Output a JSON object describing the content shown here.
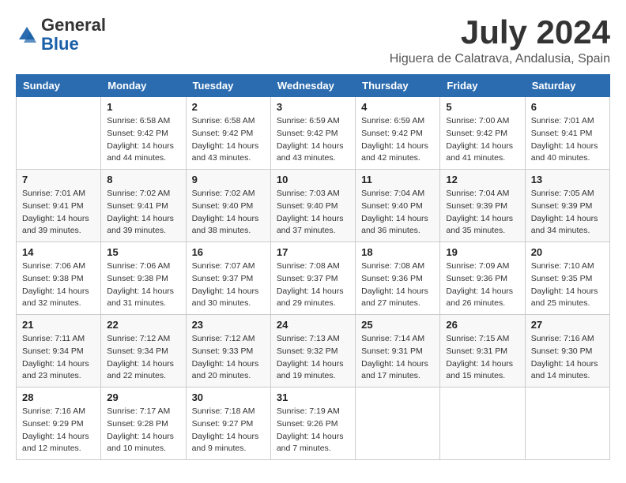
{
  "logo": {
    "general": "General",
    "blue": "Blue"
  },
  "header": {
    "month_title": "July 2024",
    "location": "Higuera de Calatrava, Andalusia, Spain"
  },
  "days_of_week": [
    "Sunday",
    "Monday",
    "Tuesday",
    "Wednesday",
    "Thursday",
    "Friday",
    "Saturday"
  ],
  "weeks": [
    [
      {
        "day": "",
        "info": ""
      },
      {
        "day": "1",
        "info": "Sunrise: 6:58 AM\nSunset: 9:42 PM\nDaylight: 14 hours\nand 44 minutes."
      },
      {
        "day": "2",
        "info": "Sunrise: 6:58 AM\nSunset: 9:42 PM\nDaylight: 14 hours\nand 43 minutes."
      },
      {
        "day": "3",
        "info": "Sunrise: 6:59 AM\nSunset: 9:42 PM\nDaylight: 14 hours\nand 43 minutes."
      },
      {
        "day": "4",
        "info": "Sunrise: 6:59 AM\nSunset: 9:42 PM\nDaylight: 14 hours\nand 42 minutes."
      },
      {
        "day": "5",
        "info": "Sunrise: 7:00 AM\nSunset: 9:42 PM\nDaylight: 14 hours\nand 41 minutes."
      },
      {
        "day": "6",
        "info": "Sunrise: 7:01 AM\nSunset: 9:41 PM\nDaylight: 14 hours\nand 40 minutes."
      }
    ],
    [
      {
        "day": "7",
        "info": "Sunrise: 7:01 AM\nSunset: 9:41 PM\nDaylight: 14 hours\nand 39 minutes."
      },
      {
        "day": "8",
        "info": "Sunrise: 7:02 AM\nSunset: 9:41 PM\nDaylight: 14 hours\nand 39 minutes."
      },
      {
        "day": "9",
        "info": "Sunrise: 7:02 AM\nSunset: 9:40 PM\nDaylight: 14 hours\nand 38 minutes."
      },
      {
        "day": "10",
        "info": "Sunrise: 7:03 AM\nSunset: 9:40 PM\nDaylight: 14 hours\nand 37 minutes."
      },
      {
        "day": "11",
        "info": "Sunrise: 7:04 AM\nSunset: 9:40 PM\nDaylight: 14 hours\nand 36 minutes."
      },
      {
        "day": "12",
        "info": "Sunrise: 7:04 AM\nSunset: 9:39 PM\nDaylight: 14 hours\nand 35 minutes."
      },
      {
        "day": "13",
        "info": "Sunrise: 7:05 AM\nSunset: 9:39 PM\nDaylight: 14 hours\nand 34 minutes."
      }
    ],
    [
      {
        "day": "14",
        "info": "Sunrise: 7:06 AM\nSunset: 9:38 PM\nDaylight: 14 hours\nand 32 minutes."
      },
      {
        "day": "15",
        "info": "Sunrise: 7:06 AM\nSunset: 9:38 PM\nDaylight: 14 hours\nand 31 minutes."
      },
      {
        "day": "16",
        "info": "Sunrise: 7:07 AM\nSunset: 9:37 PM\nDaylight: 14 hours\nand 30 minutes."
      },
      {
        "day": "17",
        "info": "Sunrise: 7:08 AM\nSunset: 9:37 PM\nDaylight: 14 hours\nand 29 minutes."
      },
      {
        "day": "18",
        "info": "Sunrise: 7:08 AM\nSunset: 9:36 PM\nDaylight: 14 hours\nand 27 minutes."
      },
      {
        "day": "19",
        "info": "Sunrise: 7:09 AM\nSunset: 9:36 PM\nDaylight: 14 hours\nand 26 minutes."
      },
      {
        "day": "20",
        "info": "Sunrise: 7:10 AM\nSunset: 9:35 PM\nDaylight: 14 hours\nand 25 minutes."
      }
    ],
    [
      {
        "day": "21",
        "info": "Sunrise: 7:11 AM\nSunset: 9:34 PM\nDaylight: 14 hours\nand 23 minutes."
      },
      {
        "day": "22",
        "info": "Sunrise: 7:12 AM\nSunset: 9:34 PM\nDaylight: 14 hours\nand 22 minutes."
      },
      {
        "day": "23",
        "info": "Sunrise: 7:12 AM\nSunset: 9:33 PM\nDaylight: 14 hours\nand 20 minutes."
      },
      {
        "day": "24",
        "info": "Sunrise: 7:13 AM\nSunset: 9:32 PM\nDaylight: 14 hours\nand 19 minutes."
      },
      {
        "day": "25",
        "info": "Sunrise: 7:14 AM\nSunset: 9:31 PM\nDaylight: 14 hours\nand 17 minutes."
      },
      {
        "day": "26",
        "info": "Sunrise: 7:15 AM\nSunset: 9:31 PM\nDaylight: 14 hours\nand 15 minutes."
      },
      {
        "day": "27",
        "info": "Sunrise: 7:16 AM\nSunset: 9:30 PM\nDaylight: 14 hours\nand 14 minutes."
      }
    ],
    [
      {
        "day": "28",
        "info": "Sunrise: 7:16 AM\nSunset: 9:29 PM\nDaylight: 14 hours\nand 12 minutes."
      },
      {
        "day": "29",
        "info": "Sunrise: 7:17 AM\nSunset: 9:28 PM\nDaylight: 14 hours\nand 10 minutes."
      },
      {
        "day": "30",
        "info": "Sunrise: 7:18 AM\nSunset: 9:27 PM\nDaylight: 14 hours\nand 9 minutes."
      },
      {
        "day": "31",
        "info": "Sunrise: 7:19 AM\nSunset: 9:26 PM\nDaylight: 14 hours\nand 7 minutes."
      },
      {
        "day": "",
        "info": ""
      },
      {
        "day": "",
        "info": ""
      },
      {
        "day": "",
        "info": ""
      }
    ]
  ]
}
